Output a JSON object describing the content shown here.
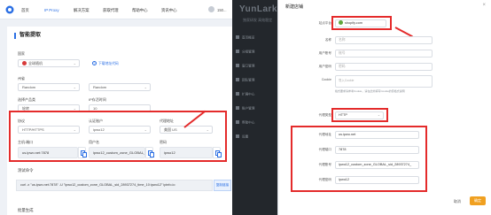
{
  "left": {
    "nav": {
      "home": "首页",
      "ip_pool": "IP Proxy",
      "solutions": "解决方案",
      "buy_proxy": "获取代理",
      "help": "帮助中心",
      "resources": "资讯中心"
    },
    "user_text": "150...",
    "title": "智能提取",
    "country_label": "国家",
    "country_value": "全球随机",
    "region_link": "下载地址代码",
    "state_label": "州省",
    "state_value": "Random",
    "city_value": "Random",
    "protocol_label": "选择产品类",
    "protocol_value": "轮转",
    "session_label": "IP存活时间",
    "session_value": "10",
    "protocol2_label": "协议",
    "protocol2_value": "HTTP/HTTPS",
    "account_label": "认证账户",
    "account_value": "ipwo12",
    "proxy_label": "代理地址",
    "proxy_value": "美国 US",
    "host_label": "主机:端口",
    "host_value": "us.ipwo.net:7878",
    "username_label": "用户名",
    "username_value": "ipwo12_custom_zone_GLOBAL_sid_2...",
    "password_label": "密码",
    "password_value": "ipwo12",
    "test_label": "测试命令",
    "cmd_value": "curl -x \"us.ipwo.net:7878\" -U \"ipwo12_custom_zone_GLOBAL_sid_28937274_time_10:ipwo12\" ipinfo.io",
    "copy_button": "复制链接",
    "batch_label": "批量生成"
  },
  "right": {
    "brand": "YunLark",
    "brand_sub": "独家研发 高效稳定",
    "menu": [
      "首页概览",
      "分组管理",
      "窗口管理",
      "团队管理",
      "扩展中心",
      "账户管理",
      "帮助中心",
      "设置"
    ],
    "modal_title": "新建店铺",
    "close": "×",
    "platform_label": "站点平台",
    "platform_value": "shopify.com",
    "name_label": "名称",
    "name_placeholder": "名称",
    "account_label": "用户账号",
    "account_placeholder": "账号",
    "password_label": "用户密码",
    "password_placeholder": "密码",
    "cookie_label": "Cookie",
    "cookie_placeholder": "导入Cookie",
    "hint": "格式要求请参考Cookie，请在此处填写Cookie的值格式说明",
    "proxy_type_label": "代理类型",
    "proxy_type_value": "HTTP",
    "proxy_host_label": "代理地址",
    "proxy_host_value": "us.ipwo.net",
    "proxy_port_label": "代理端口",
    "proxy_port_value": "7878",
    "proxy_user_label": "代理账号",
    "proxy_user_value": "ipwo12_custom_zone_GLOBAL_sid_28937274_",
    "proxy_pass_label": "代理密码",
    "proxy_pass_value": "ipwo12",
    "cancel": "取消",
    "ok": "确定"
  },
  "colors": {
    "accent": "#2b6fe4",
    "annotation_red": "#e42b2b",
    "confirm_orange": "#f0a020"
  }
}
